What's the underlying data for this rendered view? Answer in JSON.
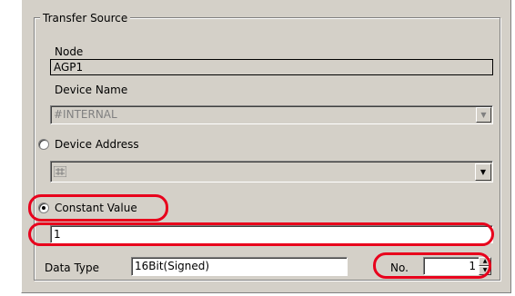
{
  "group": {
    "title": "Transfer Source"
  },
  "node": {
    "label": "Node",
    "value": "AGP1"
  },
  "device_name": {
    "label": "Device Name",
    "value": "#INTERNAL"
  },
  "device_address": {
    "label": "Device Address",
    "selected": false
  },
  "constant_value": {
    "label": "Constant Value",
    "selected": true,
    "value": "1"
  },
  "data_type": {
    "label": "Data Type",
    "value": "16Bit(Signed)"
  },
  "count": {
    "label": "No.",
    "value": "1"
  },
  "icons": {
    "dropdown": "chevron-down-icon",
    "address": "address-grid-icon",
    "spinner": "spinner-icon"
  },
  "colors": {
    "highlight": "#e8001c",
    "panel": "#d4d0c8"
  }
}
